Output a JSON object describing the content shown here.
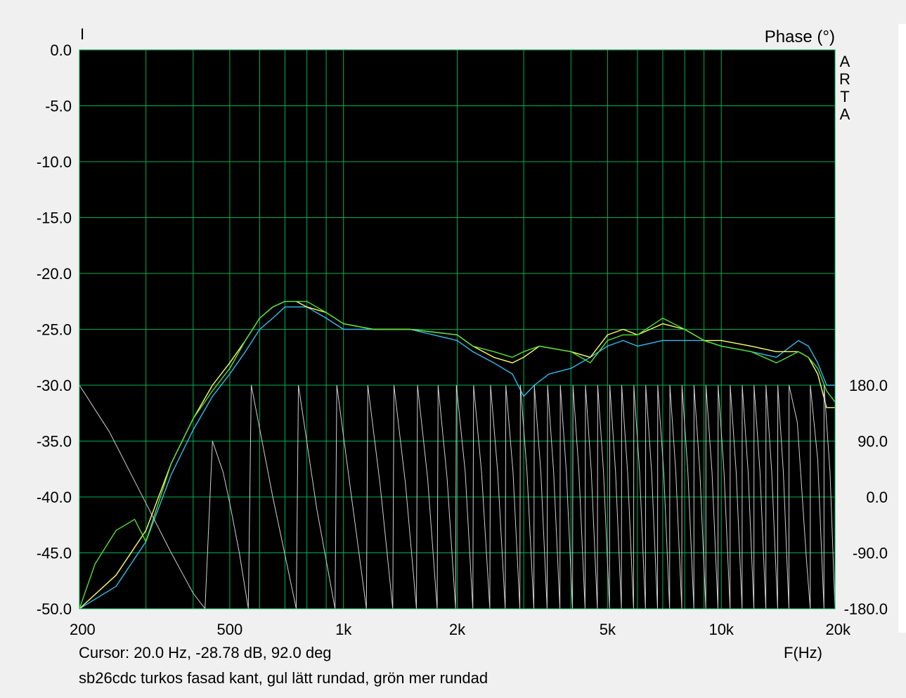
{
  "header": {
    "left_axis_marker": "I",
    "right_axis_title": "Phase (°)",
    "logo_letters": [
      "A",
      "R",
      "T",
      "A"
    ]
  },
  "footer": {
    "cursor_readout": "Cursor: 20.0 Hz, -28.78 dB, 92.0 deg",
    "caption": "sb26cdc turkos fasad kant, gul lätt rundad, grön mer rundad",
    "x_axis_title": "F(Hz)"
  },
  "colors": {
    "plot_bg": "#000000",
    "grid": "#00b050",
    "turkos": "#33bbee",
    "gul": "#ffff66",
    "gron": "#55e033",
    "phase": "#d0d0d0"
  },
  "chart_data": {
    "type": "line",
    "x_scale": "log",
    "xlim": [
      200,
      20000
    ],
    "ylim": [
      -50,
      0
    ],
    "y2lim": [
      -180,
      180
    ],
    "y_ticks": [
      0,
      -5,
      -10,
      -15,
      -20,
      -25,
      -30,
      -35,
      -40,
      -45,
      -50
    ],
    "y_tick_labels": [
      "0.0",
      "-5.0",
      "-10.0",
      "-15.0",
      "-20.0",
      "-25.0",
      "-30.0",
      "-35.0",
      "-40.0",
      "-45.0",
      "-50.0"
    ],
    "y2_ticks": [
      180,
      90,
      0,
      -90,
      -180
    ],
    "y2_tick_labels": [
      "180.0",
      "90.0",
      "0.0",
      "-90.0",
      "-180.0"
    ],
    "x_ticks": [
      200,
      500,
      1000,
      2000,
      5000,
      10000,
      20000
    ],
    "x_tick_labels": [
      "200",
      "500",
      "1k",
      "2k",
      "5k",
      "10k",
      "20k"
    ],
    "grid": true,
    "series": [
      {
        "colorKey": "turkos",
        "points": [
          [
            200,
            -50
          ],
          [
            250,
            -48
          ],
          [
            300,
            -44
          ],
          [
            350,
            -38
          ],
          [
            400,
            -34
          ],
          [
            450,
            -31
          ],
          [
            500,
            -29
          ],
          [
            550,
            -27
          ],
          [
            600,
            -25
          ],
          [
            650,
            -24
          ],
          [
            700,
            -23
          ],
          [
            750,
            -23
          ],
          [
            800,
            -23
          ],
          [
            900,
            -24
          ],
          [
            1000,
            -25
          ],
          [
            1200,
            -25
          ],
          [
            1500,
            -25
          ],
          [
            2000,
            -26
          ],
          [
            2200,
            -27
          ],
          [
            2500,
            -28
          ],
          [
            2800,
            -29
          ],
          [
            3000,
            -31
          ],
          [
            3200,
            -30
          ],
          [
            3500,
            -29
          ],
          [
            4000,
            -28.5
          ],
          [
            4500,
            -27.5
          ],
          [
            5000,
            -26.5
          ],
          [
            5500,
            -26
          ],
          [
            6000,
            -26.5
          ],
          [
            7000,
            -26
          ],
          [
            8000,
            -26
          ],
          [
            9000,
            -26
          ],
          [
            10000,
            -26.5
          ],
          [
            12000,
            -27
          ],
          [
            14000,
            -27.5
          ],
          [
            16000,
            -26
          ],
          [
            17000,
            -26.5
          ],
          [
            18000,
            -28
          ],
          [
            19000,
            -30
          ],
          [
            20000,
            -30
          ]
        ]
      },
      {
        "colorKey": "gul",
        "points": [
          [
            200,
            -50
          ],
          [
            250,
            -47
          ],
          [
            300,
            -43
          ],
          [
            350,
            -37
          ],
          [
            400,
            -33
          ],
          [
            450,
            -30
          ],
          [
            500,
            -28
          ],
          [
            550,
            -26
          ],
          [
            600,
            -24
          ],
          [
            650,
            -23
          ],
          [
            700,
            -22.5
          ],
          [
            750,
            -22.5
          ],
          [
            800,
            -23
          ],
          [
            900,
            -23.5
          ],
          [
            1000,
            -24.5
          ],
          [
            1200,
            -25
          ],
          [
            1500,
            -25
          ],
          [
            2000,
            -25.5
          ],
          [
            2200,
            -26.5
          ],
          [
            2500,
            -27.5
          ],
          [
            2800,
            -28
          ],
          [
            3000,
            -27.5
          ],
          [
            3300,
            -26.5
          ],
          [
            4000,
            -27
          ],
          [
            4500,
            -27.5
          ],
          [
            5000,
            -25.5
          ],
          [
            5500,
            -25
          ],
          [
            6000,
            -25.5
          ],
          [
            7000,
            -24.5
          ],
          [
            8000,
            -25
          ],
          [
            9000,
            -26
          ],
          [
            10000,
            -26
          ],
          [
            12000,
            -26.5
          ],
          [
            14000,
            -27
          ],
          [
            16000,
            -27
          ],
          [
            17000,
            -27.5
          ],
          [
            18000,
            -29
          ],
          [
            19000,
            -32
          ],
          [
            20000,
            -32
          ]
        ]
      },
      {
        "colorKey": "gron",
        "points": [
          [
            200,
            -50
          ],
          [
            220,
            -46
          ],
          [
            250,
            -43
          ],
          [
            280,
            -42
          ],
          [
            300,
            -44
          ],
          [
            350,
            -37
          ],
          [
            400,
            -33
          ],
          [
            450,
            -30.5
          ],
          [
            500,
            -28.5
          ],
          [
            550,
            -26
          ],
          [
            600,
            -24
          ],
          [
            650,
            -23
          ],
          [
            700,
            -22.5
          ],
          [
            800,
            -22.5
          ],
          [
            900,
            -23.5
          ],
          [
            1000,
            -24.5
          ],
          [
            1200,
            -25
          ],
          [
            1500,
            -25
          ],
          [
            2000,
            -25.5
          ],
          [
            2200,
            -26.5
          ],
          [
            2500,
            -27
          ],
          [
            2800,
            -27.5
          ],
          [
            3000,
            -27
          ],
          [
            3300,
            -26.5
          ],
          [
            4000,
            -27
          ],
          [
            4500,
            -28
          ],
          [
            5000,
            -26
          ],
          [
            5500,
            -25.5
          ],
          [
            6000,
            -25.5
          ],
          [
            7000,
            -24
          ],
          [
            8000,
            -25
          ],
          [
            9000,
            -26
          ],
          [
            10000,
            -26.5
          ],
          [
            12000,
            -27
          ],
          [
            14000,
            -28
          ],
          [
            16000,
            -27
          ],
          [
            17000,
            -27.5
          ],
          [
            18000,
            -28.5
          ],
          [
            19000,
            -30.5
          ],
          [
            20000,
            -31.5
          ]
        ]
      },
      {
        "colorKey": "phase",
        "axis": "y2",
        "points": [
          [
            200,
            180
          ],
          [
            240,
            105
          ],
          [
            300,
            -10
          ],
          [
            350,
            -90
          ],
          [
            400,
            -155
          ],
          [
            430,
            -180
          ],
          [
            450,
            90
          ],
          [
            480,
            40
          ],
          [
            500,
            -10
          ],
          [
            530,
            -90
          ],
          [
            560,
            -180
          ],
          [
            570,
            180
          ],
          [
            650,
            0
          ],
          [
            750,
            -180
          ],
          [
            760,
            180
          ],
          [
            850,
            -20
          ],
          [
            950,
            -180
          ],
          [
            960,
            180
          ],
          [
            1050,
            0
          ],
          [
            1150,
            -180
          ],
          [
            1160,
            180
          ],
          [
            1250,
            20
          ],
          [
            1350,
            -180
          ],
          [
            1360,
            180
          ],
          [
            1460,
            20
          ],
          [
            1560,
            -180
          ],
          [
            1570,
            180
          ],
          [
            1670,
            30
          ],
          [
            1770,
            -180
          ],
          [
            1780,
            180
          ],
          [
            1880,
            30
          ],
          [
            1980,
            -180
          ],
          [
            1990,
            180
          ],
          [
            2100,
            40
          ],
          [
            2200,
            -180
          ],
          [
            2210,
            180
          ],
          [
            2320,
            40
          ],
          [
            2440,
            -180
          ],
          [
            2450,
            180
          ],
          [
            2560,
            40
          ],
          [
            2680,
            -180
          ],
          [
            2690,
            180
          ],
          [
            2810,
            40
          ],
          [
            2930,
            -180
          ],
          [
            2940,
            180
          ],
          [
            3060,
            40
          ],
          [
            3190,
            -180
          ],
          [
            3200,
            180
          ],
          [
            3330,
            40
          ],
          [
            3460,
            -180
          ],
          [
            3470,
            180
          ],
          [
            3600,
            40
          ],
          [
            3740,
            -180
          ],
          [
            3750,
            180
          ],
          [
            3890,
            40
          ],
          [
            4040,
            -180
          ],
          [
            4050,
            180
          ],
          [
            4200,
            40
          ],
          [
            4360,
            -180
          ],
          [
            4370,
            180
          ],
          [
            4530,
            40
          ],
          [
            4700,
            -180
          ],
          [
            4710,
            180
          ],
          [
            4880,
            40
          ],
          [
            5060,
            -180
          ],
          [
            5070,
            180
          ],
          [
            5250,
            40
          ],
          [
            5440,
            -180
          ],
          [
            5450,
            180
          ],
          [
            5650,
            40
          ],
          [
            5860,
            -180
          ],
          [
            5870,
            180
          ],
          [
            6080,
            40
          ],
          [
            6300,
            -180
          ],
          [
            6310,
            180
          ],
          [
            6540,
            40
          ],
          [
            6780,
            -180
          ],
          [
            6790,
            180
          ],
          [
            7040,
            40
          ],
          [
            7300,
            -180
          ],
          [
            7310,
            180
          ],
          [
            7580,
            40
          ],
          [
            7860,
            -180
          ],
          [
            7870,
            180
          ],
          [
            8160,
            40
          ],
          [
            8460,
            -180
          ],
          [
            8470,
            180
          ],
          [
            8780,
            40
          ],
          [
            9100,
            -180
          ],
          [
            9110,
            180
          ],
          [
            9450,
            40
          ],
          [
            9800,
            -180
          ],
          [
            9810,
            180
          ],
          [
            10170,
            40
          ],
          [
            10550,
            -180
          ],
          [
            10560,
            180
          ],
          [
            10950,
            40
          ],
          [
            11350,
            -180
          ],
          [
            11360,
            180
          ],
          [
            11780,
            40
          ],
          [
            12200,
            -180
          ],
          [
            12210,
            180
          ],
          [
            12660,
            40
          ],
          [
            13120,
            -180
          ],
          [
            13130,
            180
          ],
          [
            13600,
            40
          ],
          [
            14100,
            -180
          ],
          [
            14110,
            180
          ],
          [
            14600,
            40
          ],
          [
            15100,
            -180
          ],
          [
            15110,
            180
          ],
          [
            15900,
            120
          ],
          [
            16800,
            -100
          ],
          [
            17200,
            -180
          ],
          [
            17210,
            180
          ],
          [
            18000,
            60
          ],
          [
            18700,
            -180
          ],
          [
            18710,
            180
          ],
          [
            19400,
            40
          ],
          [
            20000,
            -180
          ]
        ]
      }
    ]
  }
}
